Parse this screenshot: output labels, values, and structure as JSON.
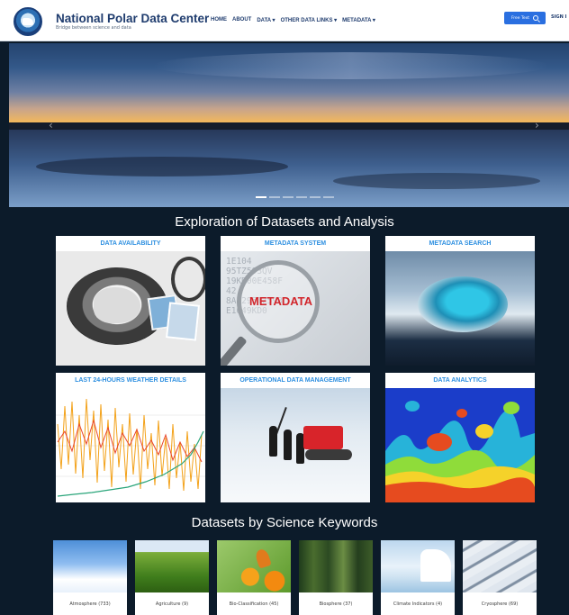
{
  "header": {
    "title": "National Polar Data Center",
    "tagline": "Bridge between science and data",
    "nav": [
      "HOME",
      "ABOUT",
      "DATA ▾",
      "OTHER DATA LINKS ▾",
      "METADATA ▾"
    ],
    "search_label": "Free Text",
    "signin_label": "SIGN I"
  },
  "hero": {
    "prev_icon": "chevron-left-icon",
    "next_icon": "chevron-right-icon",
    "slide_count": 6,
    "active_slide": 1
  },
  "section1": {
    "title": "Exploration of Datasets and Analysis",
    "cards": [
      {
        "label": "DATA AVAILABILITY"
      },
      {
        "label": "METADATA SYSTEM"
      },
      {
        "label": "METADATA SEARCH"
      },
      {
        "label": "LAST 24-HOURS WEATHER DETAILS"
      },
      {
        "label": "OPERATIONAL DATA MANAGEMENT"
      },
      {
        "label": "DATA ANALYTICS"
      }
    ],
    "metadata_image_word": "METADATA",
    "metadata_image_codes": "1E104\n95TZ593QV\n19KD00E458F\n42\n8A4295TZ593\nE1049KD0"
  },
  "section2": {
    "title": "Datasets by Science Keywords",
    "keywords": [
      {
        "label": "Atmosphere (733)"
      },
      {
        "label": "Agriculture (9)"
      },
      {
        "label": "Bio-Classification (45)"
      },
      {
        "label": "Biosphere (37)"
      },
      {
        "label": "Climate Indicators (4)"
      },
      {
        "label": "Cryosphere (69)"
      }
    ]
  },
  "colors": {
    "page_bg": "#0c1b2a",
    "brand": "#1f3c6e",
    "card_label": "#2d8fe0",
    "search_button": "#2a6fe0"
  }
}
